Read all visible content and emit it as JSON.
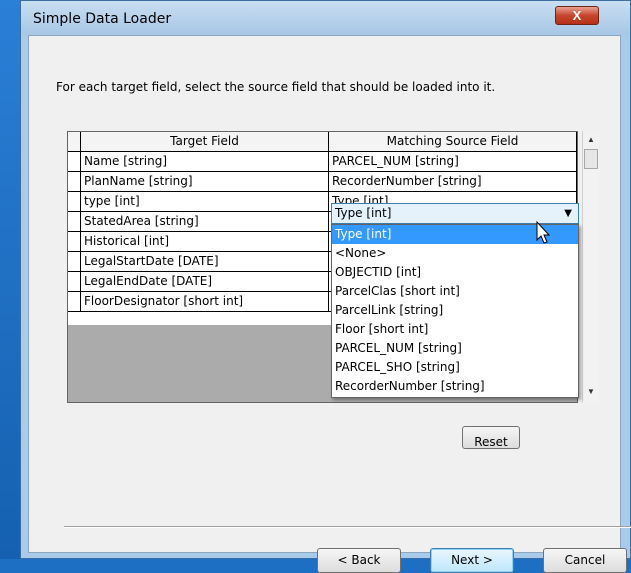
{
  "window": {
    "title": "Simple Data Loader",
    "close_label": "X"
  },
  "instruction": "For each target field, select the source field that should be loaded into it.",
  "grid": {
    "columns": [
      "Target Field",
      "Matching Source Field"
    ],
    "rows": [
      {
        "target": "Name [string]",
        "source": "PARCEL_NUM [string]"
      },
      {
        "target": "PlanName [string]",
        "source": "RecorderNumber [string]"
      },
      {
        "target": "type [int]",
        "source": "Type [int]"
      },
      {
        "target": "StatedArea [string]",
        "source": ""
      },
      {
        "target": "Historical [int]",
        "source": ""
      },
      {
        "target": "LegalStartDate [DATE]",
        "source": ""
      },
      {
        "target": "LegalEndDate [DATE]",
        "source": ""
      },
      {
        "target": "FloorDesignator [short int]",
        "source": ""
      }
    ]
  },
  "combo": {
    "selected": "Type [int]",
    "options": [
      "Type [int]",
      "<None>",
      "OBJECTID [int]",
      "ParcelClas [short int]",
      "ParcelLink [string]",
      "Floor [short int]",
      "PARCEL_NUM [string]",
      "PARCEL_SHO [string]",
      "RecorderNumber [string]"
    ],
    "highlighted_index": 0
  },
  "buttons": {
    "reset": "Reset",
    "back": "< Back",
    "next": "Next >",
    "cancel": "Cancel"
  },
  "colors": {
    "selection": "#3399ff",
    "close_button": "#c7452c",
    "window_frame": "#a9cbe9"
  }
}
